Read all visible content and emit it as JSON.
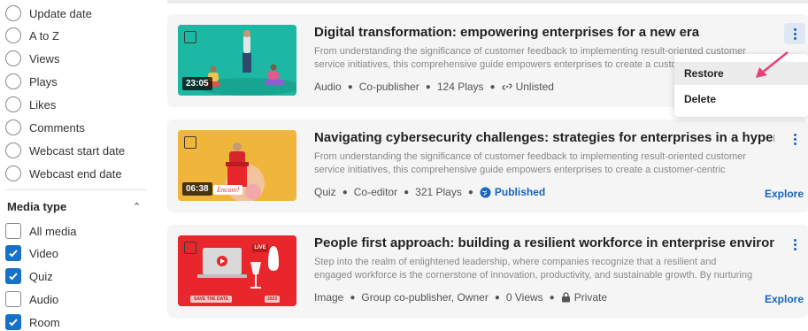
{
  "sidebar": {
    "sort_options": [
      "Update date",
      "A to Z",
      "Views",
      "Plays",
      "Likes",
      "Comments",
      "Webcast start date",
      "Webcast end date"
    ],
    "media_type": {
      "title": "Media type",
      "options": [
        {
          "label": "All media",
          "checked": false
        },
        {
          "label": "Video",
          "checked": true
        },
        {
          "label": "Quiz",
          "checked": true
        },
        {
          "label": "Audio",
          "checked": false
        },
        {
          "label": "Room",
          "checked": true
        }
      ]
    }
  },
  "cards": [
    {
      "title": "Digital transformation: empowering enterprises for a new era",
      "description": "From understanding the significance of customer feedback to implementing result-oriented customer service initiatives, this comprehensive guide empowers enterprises to create a customer-centric culture...",
      "duration": "23:05",
      "meta": [
        "Audio",
        "Co-publisher",
        "124 Plays"
      ],
      "status": "Unlisted",
      "status_icon": "link-icon",
      "thumb_color": "#1cb8a4"
    },
    {
      "title": "Navigating cybersecurity challenges: strategies for enterprises in a hyperconnec...",
      "description": "From understanding the significance of customer feedback to implementing result-oriented customer service initiatives, this comprehensive guide empowers enterprises to create a customer-centric culture...",
      "duration": "06:38",
      "thumb_tag": "Encore!",
      "meta": [
        "Quiz",
        "Co-editor",
        "321 Plays"
      ],
      "status": "Published",
      "status_icon": "globe-icon",
      "explore": "Explore",
      "thumb_color": "#f0b63c"
    },
    {
      "title": "People first approach: building a resilient workforce in enterprise environments",
      "description": "Step into the realm of enlightened leadership, where companies recognize that a resilient and engaged workforce is the cornerstone of innovation, productivity, and sustainable growth. By nurturing a culture t...",
      "thumb_badge": "LIVE",
      "thumb_tag_left": "SAVE THE DATE",
      "thumb_tag_right": "2023",
      "meta": [
        "Image",
        "Group co-publisher, Owner",
        "0 Views"
      ],
      "status": "Private",
      "status_icon": "lock-icon",
      "explore": "Explore",
      "thumb_color": "#e8262c"
    }
  ],
  "menu": {
    "items": [
      "Restore",
      "Delete"
    ],
    "hovered": "Restore"
  },
  "colors": {
    "accent": "#1565c0",
    "checkbox_checked": "#1571c9",
    "arrow": "#e8417a"
  }
}
